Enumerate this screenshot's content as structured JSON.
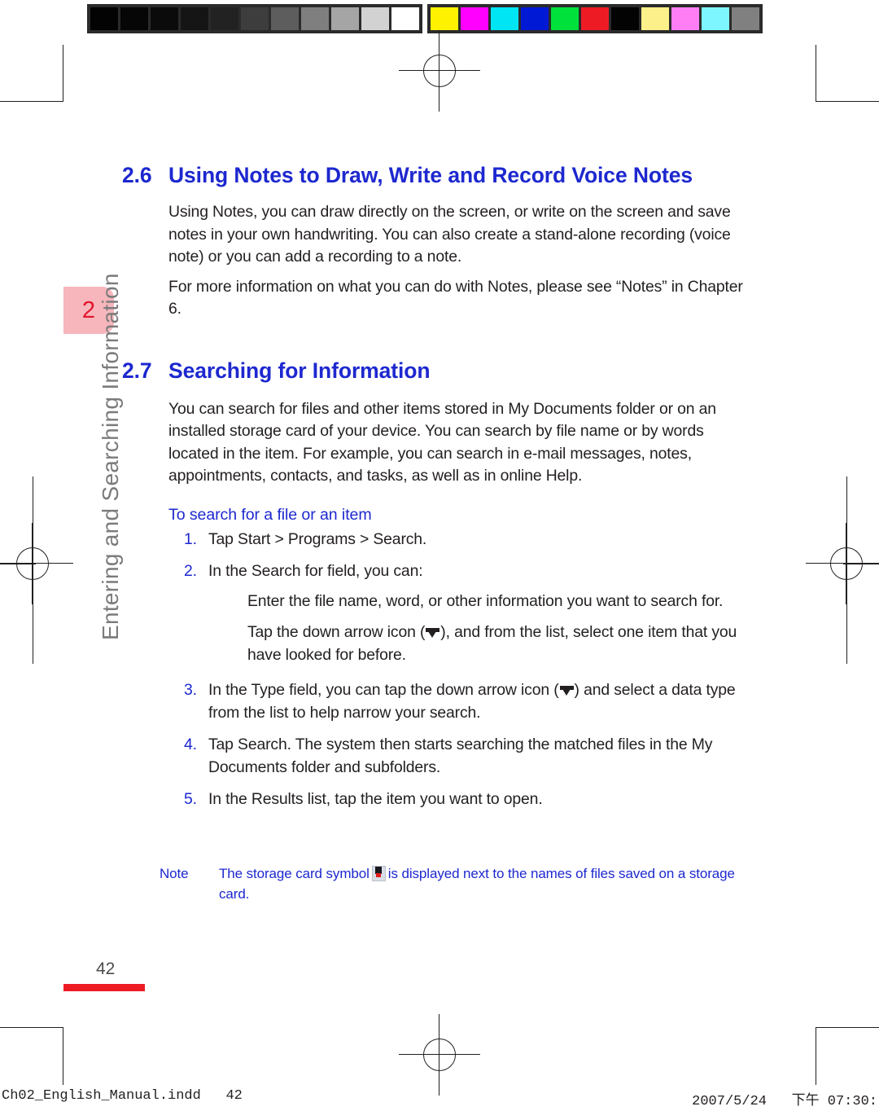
{
  "prepress": {
    "grayscale_swatches": [
      "#030303",
      "#060606",
      "#0b0b0b",
      "#151515",
      "#222222",
      "#3d3d3d",
      "#5d5d5d",
      "#7f7f7f",
      "#a5a5a5",
      "#d2d2d2",
      "#ffffff"
    ],
    "color_swatches": [
      "#fff200",
      "#ff00ff",
      "#00e5f4",
      "#0019d4",
      "#00e13c",
      "#ed1c24",
      "#030303",
      "#fcf08a",
      "#ff7ef5",
      "#7ef6ff",
      "#808080"
    ],
    "registration_mark": "registration-target"
  },
  "chapter_tab": {
    "number": "2",
    "running_title": "Entering and Searching Information",
    "tab_color": "#f6b6bb",
    "number_color": "#e2142c"
  },
  "sections": {
    "s26": {
      "number": "2.6",
      "title": "Using Notes to Draw, Write and Record Voice Notes",
      "paragraphs": [
        "Using Notes, you can draw directly on the screen, or write on the screen and save notes in your own handwriting. You can also create a stand-alone recording (voice note) or you can add a recording to a note.",
        "For more information on what you can do with Notes, please see “Notes” in Chapter 6."
      ]
    },
    "s27": {
      "number": "2.7",
      "title": "Searching for Information",
      "paragraphs": [
        "You can search for files and other items stored in My Documents folder or on an installed storage card of your device. You can search by file name or by words located in the item. For example, you can search in e-mail messages, notes, appointments, contacts, and tasks, as well as in online Help."
      ],
      "subhead": "To search for a file or an item",
      "steps": [
        {
          "marker": "1.",
          "text": "Tap Start > Programs > Search."
        },
        {
          "marker": "2.",
          "text": "In the Search for field, you can:"
        },
        {
          "marker": "3.",
          "text_before": "In the Type field, you can tap the down arrow icon (",
          "icon": "down-arrow-icon",
          "text_after": ") and select a data type from the list to help narrow your search."
        },
        {
          "marker": "4.",
          "text": "Tap Search. The system then starts searching the matched files in the My Documents folder and subfolders."
        },
        {
          "marker": "5.",
          "text": "In the Results list, tap the item you want to open."
        }
      ],
      "substeps": [
        {
          "text": "Enter the file name, word, or other information you want to search for."
        },
        {
          "text_before": "Tap the down arrow icon (",
          "icon": "down-arrow-icon",
          "text_after": "), and from the list, select one item that you have looked for before."
        }
      ]
    }
  },
  "note": {
    "label": "Note",
    "text_before": "The storage card symbol",
    "icon": "storage-card-icon",
    "text_after": "is displayed next to the names of files saved on a storage card.",
    "color": "#1d28cf"
  },
  "page": {
    "number": "42",
    "rule_color": "#ed1c24"
  },
  "footer": {
    "left": "Ch02_English_Manual.indd   42",
    "right": "2007/5/24   下午 07:30:"
  }
}
